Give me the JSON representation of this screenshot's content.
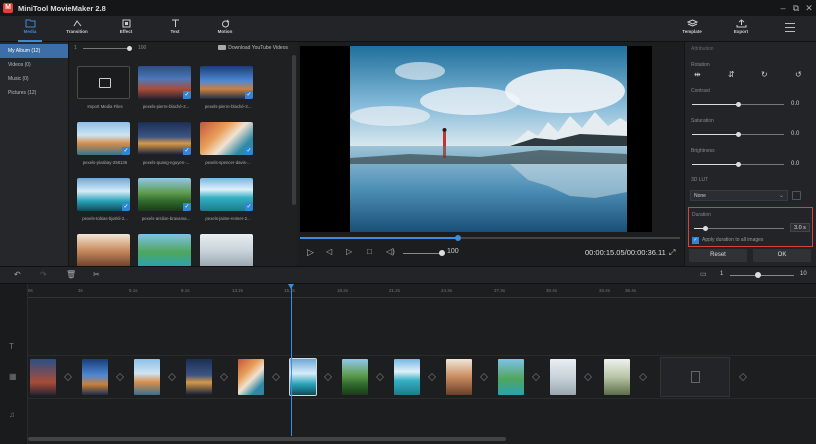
{
  "app": {
    "title": "MiniTool MovieMaker 2.8",
    "logo_letter": "M"
  },
  "window_controls": {
    "minimize": "–",
    "restore": "⧉",
    "close": "✕"
  },
  "toolbar": {
    "items": [
      {
        "label": "Media",
        "icon": "media-folder-icon"
      },
      {
        "label": "Transition",
        "icon": "transition-icon"
      },
      {
        "label": "Effect",
        "icon": "effect-icon"
      },
      {
        "label": "Text",
        "icon": "text-icon"
      },
      {
        "label": "Motion",
        "icon": "motion-icon"
      }
    ],
    "template_label": "Template",
    "export_label": "Export",
    "menu_icon": "hamburger-menu-icon",
    "accent": "#3d8bd8"
  },
  "albums": [
    {
      "label": "My Album (12)",
      "selected": true
    },
    {
      "label": "Videos (0)"
    },
    {
      "label": "Music (0)"
    },
    {
      "label": "Pictures (12)"
    }
  ],
  "media": {
    "zoom_min": "1",
    "zoom_max": "100",
    "youtube_link": "Download YouTube Videos",
    "import_label": "Import Media Files",
    "tiles": [
      "pexels-pierre-blaché-2...",
      "pexels-pierre-blaché-3...",
      "pexels-pixabay-258136",
      "pexels-quang-nguyen-...",
      "pexels-spencer-davis-...",
      "pexels-tobias-bjørkli-2...",
      "pexels-arsilon-bravama...",
      "pexels-jaime-reimer-2...",
      "",
      "",
      ""
    ]
  },
  "player": {
    "volume": "100",
    "timecode": "00:00:15.05/00:00:36.11",
    "progress_fraction": 0.42
  },
  "properties": {
    "title": "Attribution",
    "rotation_label": "Rotation",
    "contrast_label": "Contrast",
    "contrast_value": "0.0",
    "saturation_label": "Saturation",
    "saturation_value": "0.0",
    "brightness_label": "Brightness",
    "brightness_value": "0.0",
    "lut_label": "3D LUT",
    "lut_value": "None",
    "duration_label": "Duration",
    "duration_value": "3.0 s",
    "apply_all_label": "Apply duration to all images",
    "reset_label": "Reset",
    "ok_label": "OK",
    "highlight_color": "#d0453e"
  },
  "timeline": {
    "zoom_min": "1",
    "zoom_max": "10",
    "ruler": [
      "0s",
      "3s",
      "5.1s",
      "8.1s",
      "13.2s",
      "15.2s",
      "18.2s",
      "21.2s",
      "24.3s",
      "27.3s",
      "30.4s",
      "33.4s",
      "36.4s"
    ],
    "clip_count": 12
  }
}
